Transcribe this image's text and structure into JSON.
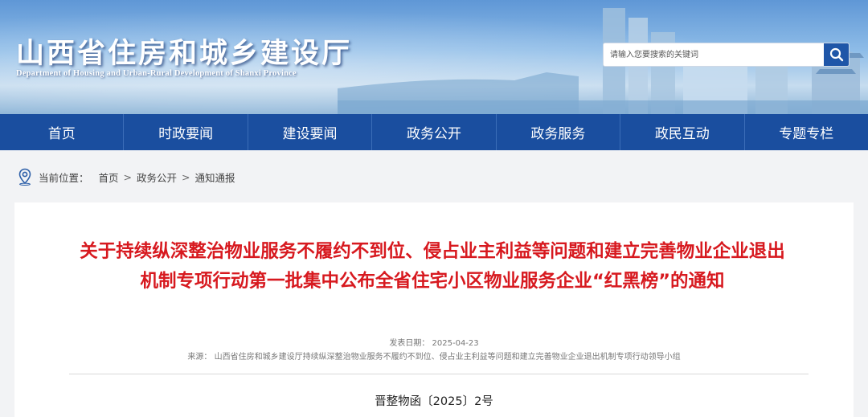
{
  "header": {
    "title": "山西省住房和城乡建设厅",
    "subtitle": "Department of Housing and Urban-Rural Development of Shanxi Province",
    "search": {
      "placeholder": "请输入您要搜索的关键词"
    }
  },
  "nav": {
    "items": [
      "首页",
      "时政要闻",
      "建设要闻",
      "政务公开",
      "政务服务",
      "政民互动",
      "专题专栏"
    ]
  },
  "breadcrumb": {
    "label": "当前位置：",
    "items": [
      "首页",
      "政务公开",
      "通知通报"
    ],
    "separator": ">"
  },
  "article": {
    "title": "关于持续纵深整治物业服务不履约不到位、侵占业主利益等问题和建立完善物业企业退出机制专项行动第一批集中公布全省住宅小区物业服务企业“红黑榜”的通知",
    "date": "发表日期：   2025-04-23",
    "source": "来源：  山西省住房和城乡建设厅持续纵深整治物业服务不履约不到位、侵占业主利益等问题和建立完善物业企业退出机制专项行动领导小组",
    "doc_number": "晋整物函〔2025〕2号"
  },
  "colors": {
    "nav_bg": "#1a4e9f",
    "title_red": "#d7191f",
    "search_button": "#1f56a8"
  },
  "icons": [
    "search-icon",
    "location-pin-icon"
  ]
}
